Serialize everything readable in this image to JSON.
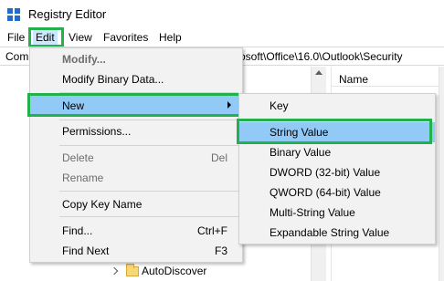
{
  "window": {
    "title": "Registry Editor"
  },
  "menubar": {
    "items": [
      "File",
      "Edit",
      "View",
      "Favorites",
      "Help"
    ]
  },
  "address": {
    "left_text": "Com",
    "right_text": "osoft\\Office\\16.0\\Outlook\\Security"
  },
  "list_pane": {
    "column_name": "Name"
  },
  "tree": {
    "visible_item": "AutoDiscover"
  },
  "edit_menu": {
    "modify": "Modify...",
    "modify_binary": "Modify Binary Data...",
    "new": "New",
    "permissions": "Permissions...",
    "delete": "Delete",
    "delete_shortcut": "Del",
    "rename": "Rename",
    "copy_key_name": "Copy Key Name",
    "find": "Find...",
    "find_shortcut": "Ctrl+F",
    "find_next": "Find Next",
    "find_next_shortcut": "F3"
  },
  "new_menu": {
    "items": [
      "Key",
      "String Value",
      "Binary Value",
      "DWORD (32-bit) Value",
      "QWORD (64-bit) Value",
      "Multi-String Value",
      "Expandable String Value"
    ],
    "selected": "String Value"
  },
  "colors": {
    "highlight_outline": "#22b14c",
    "selection": "#91c9f7",
    "menu_bg": "#f2f2f2"
  }
}
